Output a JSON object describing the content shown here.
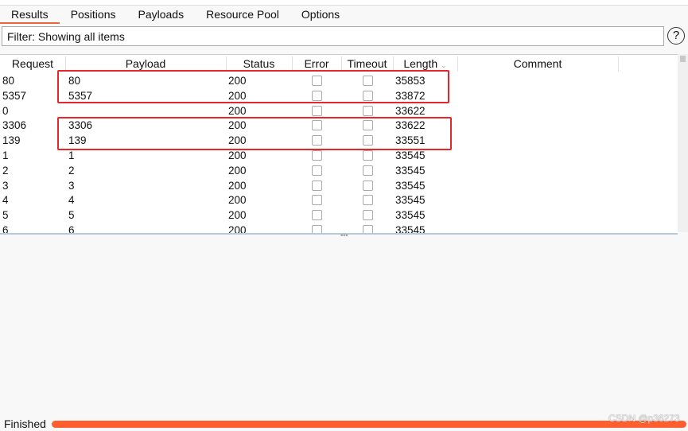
{
  "tabs": [
    {
      "label": "Results",
      "active": true
    },
    {
      "label": "Positions"
    },
    {
      "label": "Payloads"
    },
    {
      "label": "Resource Pool"
    },
    {
      "label": "Options"
    }
  ],
  "filter": {
    "text": "Filter: Showing all items",
    "help_icon": "?"
  },
  "table": {
    "columns": [
      "Request",
      "Payload",
      "Status",
      "Error",
      "Timeout",
      "Length",
      "Comment"
    ],
    "sort_column": "Length",
    "rows": [
      [
        "80",
        "80",
        "200",
        false,
        false,
        "35853",
        ""
      ],
      [
        "5357",
        "5357",
        "200",
        false,
        false,
        "33872",
        ""
      ],
      [
        "0",
        "",
        "200",
        false,
        false,
        "33622",
        ""
      ],
      [
        "3306",
        "3306",
        "200",
        false,
        false,
        "33622",
        ""
      ],
      [
        "139",
        "139",
        "200",
        false,
        false,
        "33551",
        ""
      ],
      [
        "1",
        "1",
        "200",
        false,
        false,
        "33545",
        ""
      ],
      [
        "2",
        "2",
        "200",
        false,
        false,
        "33545",
        ""
      ],
      [
        "3",
        "3",
        "200",
        false,
        false,
        "33545",
        ""
      ],
      [
        "4",
        "4",
        "200",
        false,
        false,
        "33545",
        ""
      ],
      [
        "5",
        "5",
        "200",
        false,
        false,
        "33545",
        ""
      ],
      [
        "6",
        "6",
        "200",
        false,
        false,
        "33545",
        ""
      ]
    ]
  },
  "status": {
    "text": "Finished",
    "progress_percent": 100,
    "progress_color": "#ff5f2e"
  },
  "highlight_color": "#e5262e",
  "watermark": "CSDN @p36273"
}
